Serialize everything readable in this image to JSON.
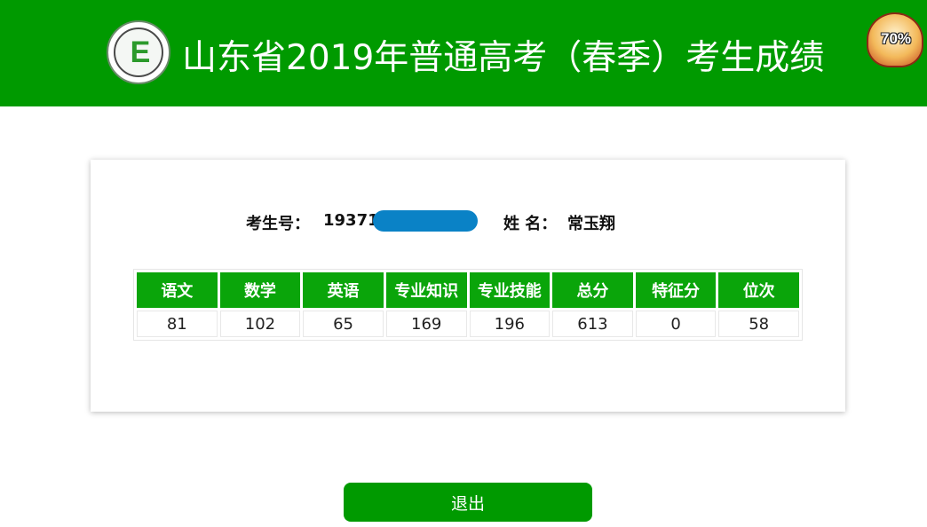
{
  "header": {
    "title": "山东省2019年普通高考（春季）考生成绩",
    "logo_letter": "E",
    "badge_text": "70%"
  },
  "info": {
    "exam_no_label": "考生号：",
    "exam_no_value": "19371",
    "name_label": "姓 名：",
    "name_value": "常玉翔"
  },
  "table": {
    "headers": [
      "语文",
      "数学",
      "英语",
      "专业知识",
      "专业技能",
      "总分",
      "特征分",
      "位次"
    ],
    "values": [
      "81",
      "102",
      "65",
      "169",
      "196",
      "613",
      "0",
      "58"
    ]
  },
  "exit_label": "退出",
  "colors": {
    "brand_green": "#009a00",
    "header_cell_green": "#0aa50a",
    "redaction_blue": "#0a82c6"
  }
}
